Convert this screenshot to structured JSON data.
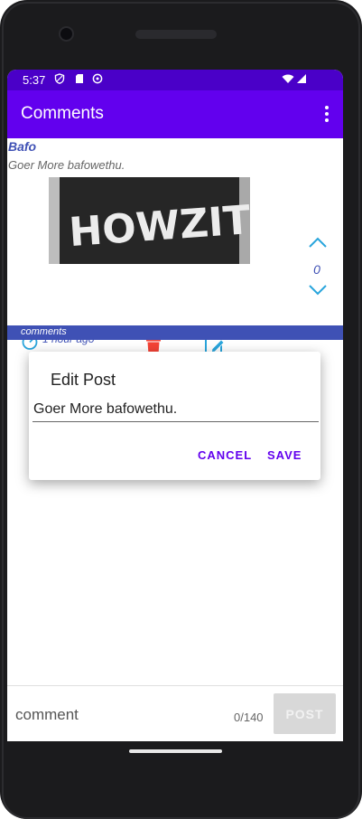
{
  "status_bar": {
    "time": "5:37"
  },
  "app_bar": {
    "title": "Comments"
  },
  "post": {
    "author": "Bafo",
    "text": "Goer More bafowethu.",
    "image_text": "HOWZIT?",
    "vote_count": "0",
    "time_ago": "1 hour ago"
  },
  "comments_header": "comments",
  "dialog": {
    "title": "Edit Post",
    "input_value": "Goer More bafowethu.",
    "cancel_label": "CANCEL",
    "save_label": "SAVE"
  },
  "composer": {
    "placeholder": "comment",
    "counter": "0/140",
    "post_label": "POST"
  },
  "colors": {
    "status_bar": "#4a00c8",
    "app_bar": "#6200ee",
    "accent_blue": "#3f51b5",
    "delete_red": "#f44336",
    "edit_blue": "#29a5dc"
  },
  "icons": [
    "shield-icon",
    "sd-card-icon",
    "sync-icon",
    "wifi-icon",
    "signal-icon",
    "more-vert-icon",
    "chevron-up-icon",
    "chevron-down-icon",
    "timer-icon",
    "trash-icon",
    "edit-icon"
  ]
}
